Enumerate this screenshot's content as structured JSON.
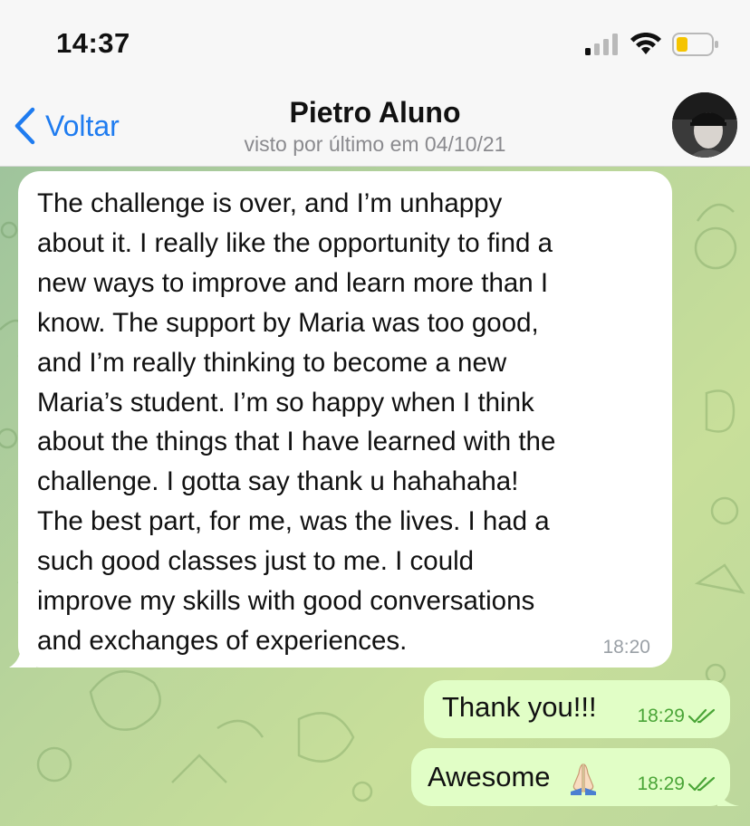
{
  "status_bar": {
    "time": "14:37",
    "icons": [
      "cellular-signal-icon",
      "wifi-icon",
      "battery-low-icon"
    ]
  },
  "nav": {
    "back_label": "Voltar",
    "title": "Pietro Aluno",
    "subtitle": "visto por último em 04/10/21"
  },
  "messages": {
    "incoming": {
      "text": "The challenge is over, and I’m unhappy\nabout it. I really like  the opportunity to find a\nnew ways to improve and learn more than I\nknow. The support by Maria was too good,\nand I’m really thinking to become a new\nMaria’s student. I’m so happy when I think\nabout the things that I have learned with the\nchallenge. I gotta say thank u hahahaha!\nThe best part, for me, was the lives. I had a\nsuch good classes just to me. I could\nimprove my skills with good conversations\nand exchanges of experiences.",
      "time": "18:20"
    },
    "outgoing": [
      {
        "text": "Thank you!!!",
        "time": "18:29",
        "status": "read"
      },
      {
        "text": "Awesome",
        "emoji": "folded-hands-icon",
        "time": "18:29",
        "status": "read"
      }
    ]
  },
  "colors": {
    "accent": "#1f7cf0",
    "outgoing_bubble": "#e1fec6",
    "incoming_bubble": "#ffffff",
    "read_check": "#4aa537",
    "battery_low": "#f5c400"
  }
}
